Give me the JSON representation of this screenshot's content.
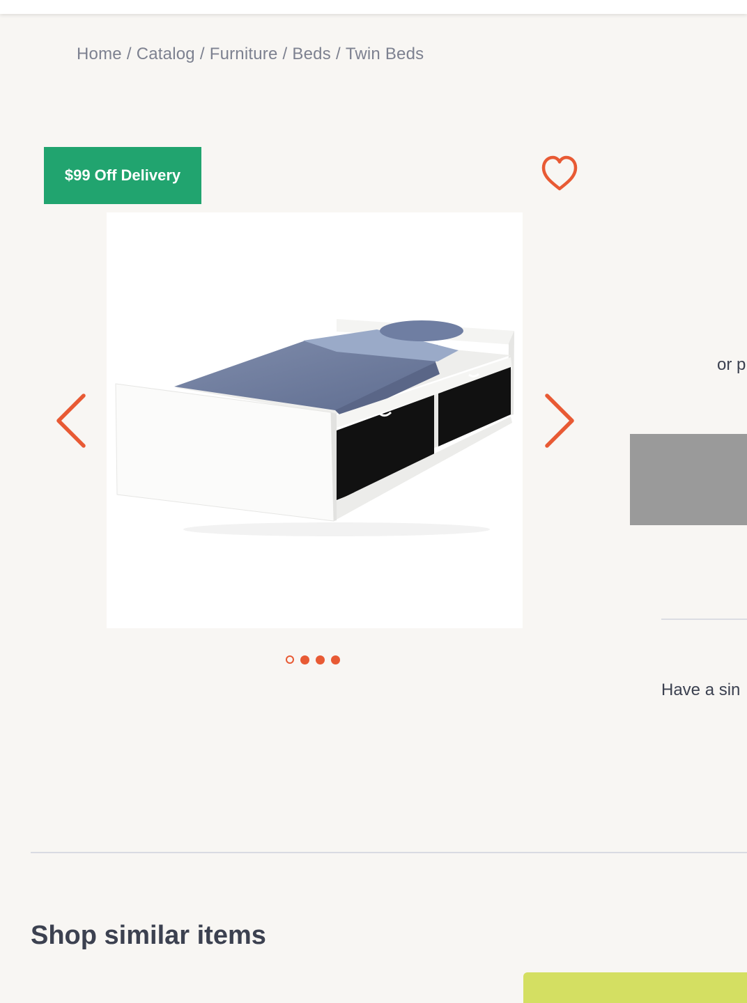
{
  "breadcrumb": {
    "items": [
      "Home",
      "Catalog",
      "Furniture",
      "Beds",
      "Twin Beds"
    ],
    "separator": "/"
  },
  "product": {
    "promo_badge": "$99 Off Delivery",
    "favorite_icon": "heart-outline-icon",
    "image_alt": "White twin bed with two black storage drawers and blue bedding",
    "carousel": {
      "prev_icon": "chevron-left-icon",
      "next_icon": "chevron-right-icon",
      "slide_count": 4,
      "active_slide": 1
    }
  },
  "side_panel": {
    "or_text": "or p",
    "have_text": "Have a sin"
  },
  "similar": {
    "title": "Shop similar items"
  },
  "colors": {
    "accent": "#e85a34",
    "badge_bg": "#21a46f",
    "page_bg": "#f8f6f3",
    "text": "#3c4150",
    "muted_text": "#7d8190",
    "placeholder_gray": "#9a9a9a",
    "lime": "#d4df62"
  }
}
